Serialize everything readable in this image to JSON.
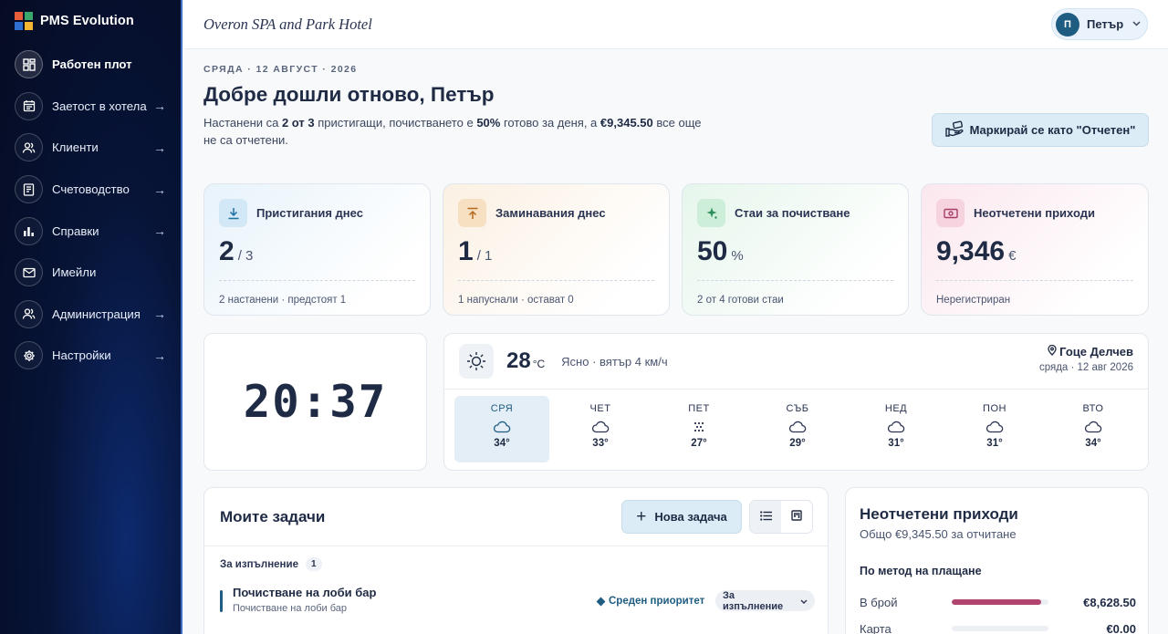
{
  "brand": {
    "name": "PMS Evolution",
    "logo_colors": [
      "#e85d3a",
      "#3aa76d",
      "#2f6fd0",
      "#f2b632"
    ]
  },
  "sidebar": {
    "items": [
      {
        "label": "Работен плот",
        "icon": "dashboard-icon",
        "active": true,
        "arrow": ""
      },
      {
        "label": "Заетост в хотела",
        "icon": "calendar-icon",
        "active": false,
        "arrow": "→"
      },
      {
        "label": "Клиенти",
        "icon": "users-icon",
        "active": false,
        "arrow": "→"
      },
      {
        "label": "Счетоводство",
        "icon": "ledger-icon",
        "active": false,
        "arrow": "→"
      },
      {
        "label": "Справки",
        "icon": "bar-chart-icon",
        "active": false,
        "arrow": "→"
      },
      {
        "label": "Имейли",
        "icon": "mail-icon",
        "active": false,
        "arrow": ""
      },
      {
        "label": "Администрация",
        "icon": "admin-users-icon",
        "active": false,
        "arrow": "→"
      },
      {
        "label": "Настройки",
        "icon": "gear-icon",
        "active": false,
        "arrow": "→"
      }
    ]
  },
  "topbar": {
    "hotel_name": "Overon SPA and Park Hotel",
    "user_initial": "П",
    "user_name": "Петър"
  },
  "header": {
    "date_eyebrow": "СРЯДА · 12 АВГУСТ · 2026",
    "welcome": "Добре дошли отново, Петър",
    "summary_1": "Настанени са ",
    "summary_2": "2 от 3",
    "summary_3": " пристигащи, почистването е ",
    "summary_4": "50%",
    "summary_5": " готово за деня, а ",
    "summary_6": "€9,345.50",
    "summary_7": " все още не са отчетени.",
    "checkin_button": "Маркирай се като \"Отчетен\""
  },
  "stats": [
    {
      "title": "Пристигания днес",
      "value": "2",
      "suffix": "/ 3",
      "foot": "2 настанени · предстоят 1",
      "icon": "download-icon",
      "accent": "#3b8fbf"
    },
    {
      "title": "Заминавания днес",
      "value": "1",
      "suffix": "/ 1",
      "foot": "1 напуснали · остават 0",
      "icon": "upload-icon",
      "accent": "#d08a3a"
    },
    {
      "title": "Стаи за почистване",
      "value": "50",
      "suffix": "%",
      "foot": "2 от 4 готови стаи",
      "icon": "sparkle-icon",
      "accent": "#3aa76d"
    },
    {
      "title": "Неотчетени приходи",
      "value": "9,346",
      "suffix": "€",
      "foot": "Нерегистриран",
      "icon": "cash-icon",
      "accent": "#c0507a"
    }
  ],
  "clock": {
    "time": "20:37"
  },
  "weather": {
    "temp": "28",
    "unit": "°C",
    "desc": "Ясно · вятър 4 км/ч",
    "city": "Гоце Делчев",
    "date": "сряда · 12 авг 2026",
    "days": [
      {
        "name": "СРЯ",
        "temp": "34°",
        "icon": "cloud-icon",
        "active": true
      },
      {
        "name": "ЧЕТ",
        "temp": "33°",
        "icon": "cloud-icon",
        "active": false
      },
      {
        "name": "ПЕТ",
        "temp": "27°",
        "icon": "snow-icon",
        "active": false
      },
      {
        "name": "СЪБ",
        "temp": "29°",
        "icon": "cloud-icon",
        "active": false
      },
      {
        "name": "НЕД",
        "temp": "31°",
        "icon": "cloud-icon",
        "active": false
      },
      {
        "name": "ПОН",
        "temp": "31°",
        "icon": "cloud-icon",
        "active": false
      },
      {
        "name": "ВТО",
        "temp": "34°",
        "icon": "cloud-icon",
        "active": false
      }
    ]
  },
  "tasks": {
    "title": "Моите задачи",
    "new_task": "Нова задача",
    "group_label": "За изпълнение",
    "group_count": "1",
    "items": [
      {
        "title": "Почистване на лоби бар",
        "subtitle": "Почистване на лоби бар",
        "priority": "Среден приоритет",
        "status": "За изпълнение"
      }
    ]
  },
  "revenue": {
    "title": "Неотчетени приходи",
    "total": "Общо €9,345.50 за отчитане",
    "section": "По метод на плащане",
    "rows": [
      {
        "label": "В брой",
        "amount": "€8,628.50",
        "share": 0.92
      },
      {
        "label": "Карта",
        "amount": "€0.00",
        "share": 0
      }
    ]
  }
}
